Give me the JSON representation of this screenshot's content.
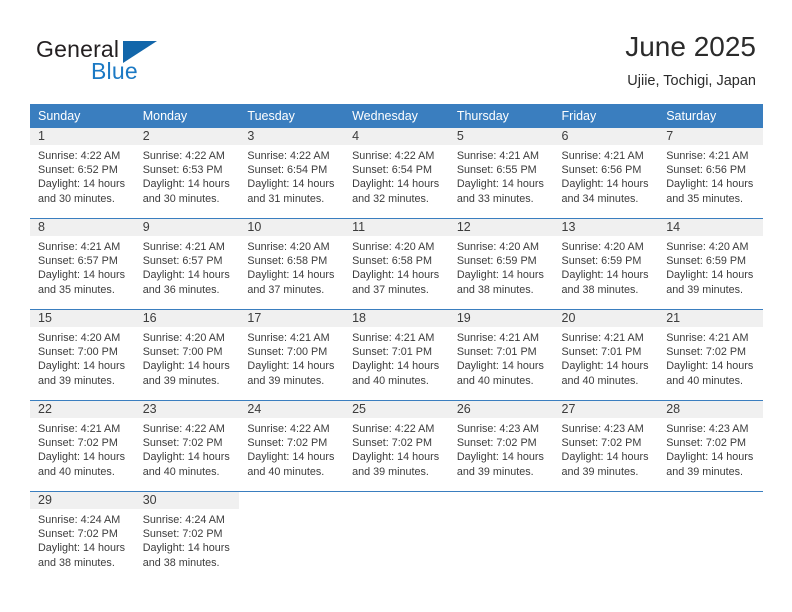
{
  "logo": {
    "word_top": "General",
    "word_bottom": "Blue",
    "triangle_icon": "triangle-icon",
    "color_dark": "#231f20",
    "color_blue": "#1b79c4"
  },
  "header": {
    "title": "June 2025",
    "subtitle": "Ujiie, Tochigi, Japan"
  },
  "theme": {
    "header_blue": "#3a7ebf",
    "day_band_gray": "#f0f0f0",
    "text": "#3c3c3c"
  },
  "calendar": {
    "weekday_headers": [
      "Sunday",
      "Monday",
      "Tuesday",
      "Wednesday",
      "Thursday",
      "Friday",
      "Saturday"
    ],
    "weeks": [
      [
        {
          "day": "1",
          "sunrise": "Sunrise: 4:22 AM",
          "sunset": "Sunset: 6:52 PM",
          "daylight_1": "Daylight: 14 hours",
          "daylight_2": "and 30 minutes."
        },
        {
          "day": "2",
          "sunrise": "Sunrise: 4:22 AM",
          "sunset": "Sunset: 6:53 PM",
          "daylight_1": "Daylight: 14 hours",
          "daylight_2": "and 30 minutes."
        },
        {
          "day": "3",
          "sunrise": "Sunrise: 4:22 AM",
          "sunset": "Sunset: 6:54 PM",
          "daylight_1": "Daylight: 14 hours",
          "daylight_2": "and 31 minutes."
        },
        {
          "day": "4",
          "sunrise": "Sunrise: 4:22 AM",
          "sunset": "Sunset: 6:54 PM",
          "daylight_1": "Daylight: 14 hours",
          "daylight_2": "and 32 minutes."
        },
        {
          "day": "5",
          "sunrise": "Sunrise: 4:21 AM",
          "sunset": "Sunset: 6:55 PM",
          "daylight_1": "Daylight: 14 hours",
          "daylight_2": "and 33 minutes."
        },
        {
          "day": "6",
          "sunrise": "Sunrise: 4:21 AM",
          "sunset": "Sunset: 6:56 PM",
          "daylight_1": "Daylight: 14 hours",
          "daylight_2": "and 34 minutes."
        },
        {
          "day": "7",
          "sunrise": "Sunrise: 4:21 AM",
          "sunset": "Sunset: 6:56 PM",
          "daylight_1": "Daylight: 14 hours",
          "daylight_2": "and 35 minutes."
        }
      ],
      [
        {
          "day": "8",
          "sunrise": "Sunrise: 4:21 AM",
          "sunset": "Sunset: 6:57 PM",
          "daylight_1": "Daylight: 14 hours",
          "daylight_2": "and 35 minutes."
        },
        {
          "day": "9",
          "sunrise": "Sunrise: 4:21 AM",
          "sunset": "Sunset: 6:57 PM",
          "daylight_1": "Daylight: 14 hours",
          "daylight_2": "and 36 minutes."
        },
        {
          "day": "10",
          "sunrise": "Sunrise: 4:20 AM",
          "sunset": "Sunset: 6:58 PM",
          "daylight_1": "Daylight: 14 hours",
          "daylight_2": "and 37 minutes."
        },
        {
          "day": "11",
          "sunrise": "Sunrise: 4:20 AM",
          "sunset": "Sunset: 6:58 PM",
          "daylight_1": "Daylight: 14 hours",
          "daylight_2": "and 37 minutes."
        },
        {
          "day": "12",
          "sunrise": "Sunrise: 4:20 AM",
          "sunset": "Sunset: 6:59 PM",
          "daylight_1": "Daylight: 14 hours",
          "daylight_2": "and 38 minutes."
        },
        {
          "day": "13",
          "sunrise": "Sunrise: 4:20 AM",
          "sunset": "Sunset: 6:59 PM",
          "daylight_1": "Daylight: 14 hours",
          "daylight_2": "and 38 minutes."
        },
        {
          "day": "14",
          "sunrise": "Sunrise: 4:20 AM",
          "sunset": "Sunset: 6:59 PM",
          "daylight_1": "Daylight: 14 hours",
          "daylight_2": "and 39 minutes."
        }
      ],
      [
        {
          "day": "15",
          "sunrise": "Sunrise: 4:20 AM",
          "sunset": "Sunset: 7:00 PM",
          "daylight_1": "Daylight: 14 hours",
          "daylight_2": "and 39 minutes."
        },
        {
          "day": "16",
          "sunrise": "Sunrise: 4:20 AM",
          "sunset": "Sunset: 7:00 PM",
          "daylight_1": "Daylight: 14 hours",
          "daylight_2": "and 39 minutes."
        },
        {
          "day": "17",
          "sunrise": "Sunrise: 4:21 AM",
          "sunset": "Sunset: 7:00 PM",
          "daylight_1": "Daylight: 14 hours",
          "daylight_2": "and 39 minutes."
        },
        {
          "day": "18",
          "sunrise": "Sunrise: 4:21 AM",
          "sunset": "Sunset: 7:01 PM",
          "daylight_1": "Daylight: 14 hours",
          "daylight_2": "and 40 minutes."
        },
        {
          "day": "19",
          "sunrise": "Sunrise: 4:21 AM",
          "sunset": "Sunset: 7:01 PM",
          "daylight_1": "Daylight: 14 hours",
          "daylight_2": "and 40 minutes."
        },
        {
          "day": "20",
          "sunrise": "Sunrise: 4:21 AM",
          "sunset": "Sunset: 7:01 PM",
          "daylight_1": "Daylight: 14 hours",
          "daylight_2": "and 40 minutes."
        },
        {
          "day": "21",
          "sunrise": "Sunrise: 4:21 AM",
          "sunset": "Sunset: 7:02 PM",
          "daylight_1": "Daylight: 14 hours",
          "daylight_2": "and 40 minutes."
        }
      ],
      [
        {
          "day": "22",
          "sunrise": "Sunrise: 4:21 AM",
          "sunset": "Sunset: 7:02 PM",
          "daylight_1": "Daylight: 14 hours",
          "daylight_2": "and 40 minutes."
        },
        {
          "day": "23",
          "sunrise": "Sunrise: 4:22 AM",
          "sunset": "Sunset: 7:02 PM",
          "daylight_1": "Daylight: 14 hours",
          "daylight_2": "and 40 minutes."
        },
        {
          "day": "24",
          "sunrise": "Sunrise: 4:22 AM",
          "sunset": "Sunset: 7:02 PM",
          "daylight_1": "Daylight: 14 hours",
          "daylight_2": "and 40 minutes."
        },
        {
          "day": "25",
          "sunrise": "Sunrise: 4:22 AM",
          "sunset": "Sunset: 7:02 PM",
          "daylight_1": "Daylight: 14 hours",
          "daylight_2": "and 39 minutes."
        },
        {
          "day": "26",
          "sunrise": "Sunrise: 4:23 AM",
          "sunset": "Sunset: 7:02 PM",
          "daylight_1": "Daylight: 14 hours",
          "daylight_2": "and 39 minutes."
        },
        {
          "day": "27",
          "sunrise": "Sunrise: 4:23 AM",
          "sunset": "Sunset: 7:02 PM",
          "daylight_1": "Daylight: 14 hours",
          "daylight_2": "and 39 minutes."
        },
        {
          "day": "28",
          "sunrise": "Sunrise: 4:23 AM",
          "sunset": "Sunset: 7:02 PM",
          "daylight_1": "Daylight: 14 hours",
          "daylight_2": "and 39 minutes."
        }
      ],
      [
        {
          "day": "29",
          "sunrise": "Sunrise: 4:24 AM",
          "sunset": "Sunset: 7:02 PM",
          "daylight_1": "Daylight: 14 hours",
          "daylight_2": "and 38 minutes."
        },
        {
          "day": "30",
          "sunrise": "Sunrise: 4:24 AM",
          "sunset": "Sunset: 7:02 PM",
          "daylight_1": "Daylight: 14 hours",
          "daylight_2": "and 38 minutes."
        },
        {
          "day": "",
          "sunrise": "",
          "sunset": "",
          "daylight_1": "",
          "daylight_2": ""
        },
        {
          "day": "",
          "sunrise": "",
          "sunset": "",
          "daylight_1": "",
          "daylight_2": ""
        },
        {
          "day": "",
          "sunrise": "",
          "sunset": "",
          "daylight_1": "",
          "daylight_2": ""
        },
        {
          "day": "",
          "sunrise": "",
          "sunset": "",
          "daylight_1": "",
          "daylight_2": ""
        },
        {
          "day": "",
          "sunrise": "",
          "sunset": "",
          "daylight_1": "",
          "daylight_2": ""
        }
      ]
    ]
  }
}
